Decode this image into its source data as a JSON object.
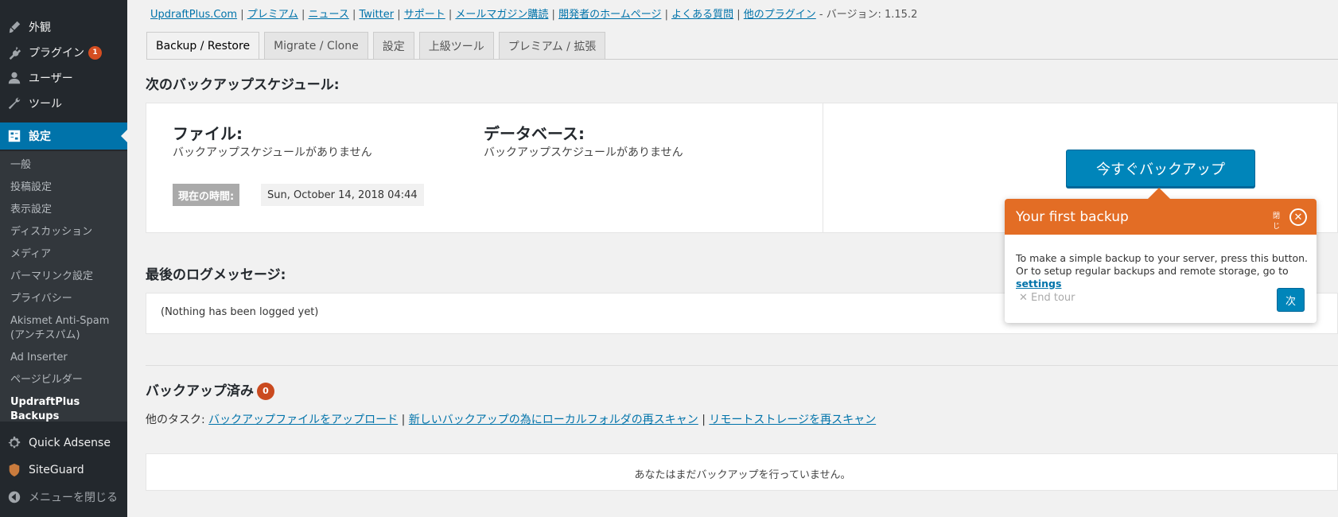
{
  "sidebar": {
    "menu": [
      {
        "label": "外観",
        "icon": "paintbrush-icon"
      },
      {
        "label": "プラグイン",
        "icon": "plugin-icon",
        "badge": "1"
      },
      {
        "label": "ユーザー",
        "icon": "user-icon"
      },
      {
        "label": "ツール",
        "icon": "wrench-icon"
      },
      {
        "label": "設定",
        "icon": "settings-icon",
        "active": true
      }
    ],
    "submenu": [
      "一般",
      "投稿設定",
      "表示設定",
      "ディスカッション",
      "メディア",
      "パーマリンク設定",
      "プライバシー",
      "Akismet Anti-Spam (アンチスパム)",
      "Ad Inserter",
      "ページビルダー",
      "UpdraftPlus Backups"
    ],
    "bottom_menu": [
      {
        "label": "Quick Adsense",
        "icon": "gear-icon"
      },
      {
        "label": "SiteGuard",
        "icon": "shield-icon"
      },
      {
        "label": "メニューを閉じる",
        "icon": "collapse-icon"
      }
    ]
  },
  "top_links": {
    "links": [
      "UpdraftPlus.Com",
      "プレミアム",
      "ニュース",
      "Twitter",
      "サポート",
      "メールマガジン購読",
      "開発者のホームページ",
      "よくある質問",
      "他のプラグイン"
    ],
    "separator": " | ",
    "version_text": " - バージョン: 1.15.2"
  },
  "tabs": [
    "Backup / Restore",
    "Migrate / Clone",
    "設定",
    "上級ツール",
    "プレミアム / 拡張"
  ],
  "schedule": {
    "heading": "次のバックアップスケジュール:",
    "files_title": "ファイル:",
    "files_text": "バックアップスケジュールがありません",
    "db_title": "データベース:",
    "db_text": "バックアップスケジュールがありません",
    "time_label": "現在の時間:",
    "time_value": "Sun, October 14, 2018 04:44",
    "backup_now": "今すぐバックアップ"
  },
  "log": {
    "heading": "最後のログメッセージ:",
    "text": "(Nothing has been logged yet)"
  },
  "existing": {
    "heading": "バックアップ済み",
    "count": "0",
    "tasks_label": "他のタスク:",
    "task_links": [
      "バックアップファイルをアップロード",
      "新しいバックアップの為にローカルフォルダの再スキャン",
      "リモートストレージを再スキャン"
    ],
    "empty_text": "あなたはまだバックアップを行っていません。"
  },
  "tour": {
    "title": "Your first backup",
    "close_label": "閉じ",
    "body": "To make a simple backup to your server, press this button. Or to setup regular backups and remote storage, go to ",
    "body_link": "settings",
    "end_tour": "End tour",
    "next": "次"
  },
  "colors": {
    "sidebar_bg": "#23282d",
    "active_blue": "#0073aa",
    "button_blue": "#0085ba",
    "tour_orange": "#e36d25",
    "badge_red": "#d54e21"
  }
}
